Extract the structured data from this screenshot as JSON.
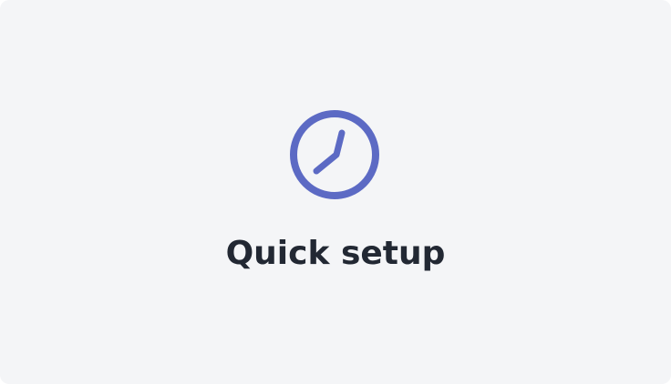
{
  "card": {
    "title": "Quick setup",
    "icon": "clock-icon"
  },
  "colors": {
    "background": "#f4f5f7",
    "accent": "#5c6ac4",
    "text": "#222833"
  }
}
